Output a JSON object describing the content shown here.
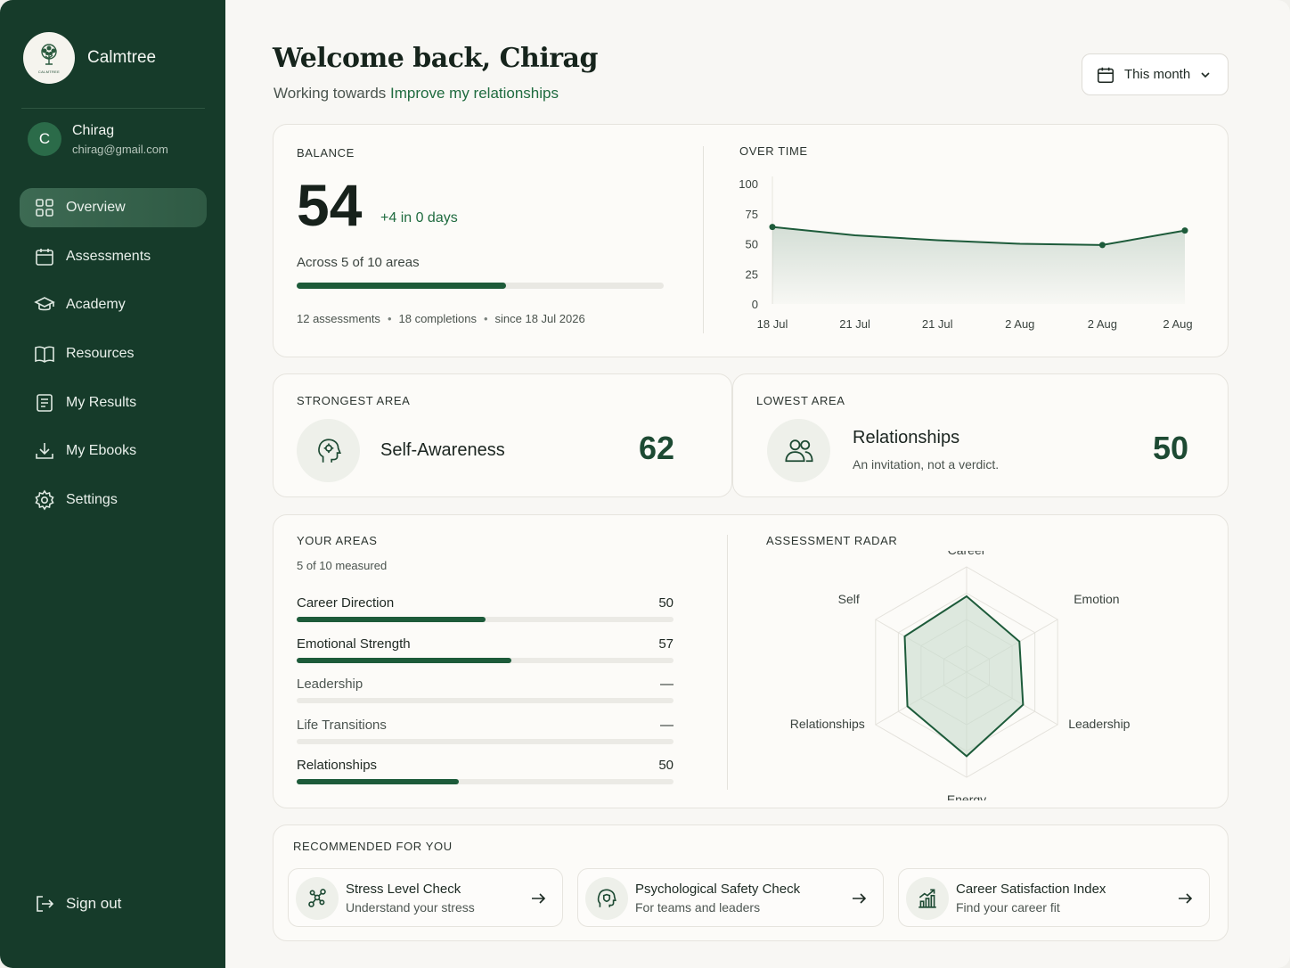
{
  "brand": {
    "name": "Calmtree",
    "logo_text": "CALMTREE"
  },
  "user": {
    "initial": "C",
    "name": "Chirag",
    "email": "chirag@gmail.com"
  },
  "nav": [
    {
      "label": "Overview",
      "icon": "grid-icon",
      "active": true
    },
    {
      "label": "Assessments",
      "icon": "calendar-icon"
    },
    {
      "label": "Academy",
      "icon": "graduation-cap-icon"
    },
    {
      "label": "Resources",
      "icon": "book-icon"
    },
    {
      "label": "My Results",
      "icon": "document-icon"
    },
    {
      "label": "My Ebooks",
      "icon": "download-icon"
    },
    {
      "label": "Settings",
      "icon": "gear-icon"
    }
  ],
  "signout_label": "Sign out",
  "header": {
    "welcome": "Welcome back, Chirag",
    "subtitle_prefix": "Working towards",
    "goal": "Improve my relationships",
    "range": "This month"
  },
  "balance": {
    "label": "BALANCE",
    "value": "54",
    "delta": "+4 in 0 days",
    "across": "Across 5 of 10 areas",
    "progress_fraction": 0.57,
    "meta": [
      "12 assessments",
      "18 completions",
      "since 18 Jul 2026"
    ]
  },
  "over_time": {
    "label": "OVER TIME",
    "chart_data": {
      "type": "area",
      "x": [
        "18 Jul",
        "21 Jul",
        "21 Jul",
        "2 Aug",
        "2 Aug",
        "2 Aug"
      ],
      "values": [
        64,
        57,
        53,
        50,
        49,
        61
      ],
      "y_ticks": [
        100,
        75,
        50,
        25,
        0
      ],
      "ylim": [
        0,
        100
      ],
      "marker_indices": [
        0,
        4,
        5
      ],
      "grid": false,
      "color": "#1d5b3a"
    }
  },
  "strongest": {
    "label": "STRONGEST AREA",
    "name": "Self-Awareness",
    "score": "62"
  },
  "lowest": {
    "label": "LOWEST AREA",
    "name": "Relationships",
    "note": "An invitation, not a verdict.",
    "score": "50"
  },
  "areas": {
    "label": "YOUR AREAS",
    "sub": "5 of 10 measured",
    "items": [
      {
        "name": "Career Direction",
        "value": "50",
        "fraction": 0.5
      },
      {
        "name": "Emotional Strength",
        "value": "57",
        "fraction": 0.57
      },
      {
        "name": "Leadership",
        "value": "—",
        "fraction": 0
      },
      {
        "name": "Life Transitions",
        "value": "—",
        "fraction": 0
      },
      {
        "name": "Relationships",
        "value": "50",
        "fraction": 0.43
      }
    ]
  },
  "radar": {
    "label": "ASSESSMENT RADAR",
    "chart_data": {
      "type": "radar",
      "axes": [
        "Career",
        "Emotion",
        "Leadership",
        "Energy",
        "Relationships",
        "Self"
      ],
      "values": [
        0.72,
        0.58,
        0.62,
        0.8,
        0.65,
        0.68
      ],
      "max": 1,
      "levels": 4,
      "color": "#1d5b3a"
    }
  },
  "recommended": {
    "label": "RECOMMENDED FOR YOU",
    "items": [
      {
        "title": "Stress Level Check",
        "sub": "Understand your stress",
        "icon": "molecule-icon"
      },
      {
        "title": "Psychological Safety Check",
        "sub": "For teams and leaders",
        "icon": "head-shield-icon"
      },
      {
        "title": "Career Satisfaction Index",
        "sub": "Find your career fit",
        "icon": "growth-chart-icon"
      }
    ]
  },
  "colors": {
    "sidebar": "#163b2a",
    "accent": "#1d5b3a",
    "link": "#1f6b3f"
  }
}
